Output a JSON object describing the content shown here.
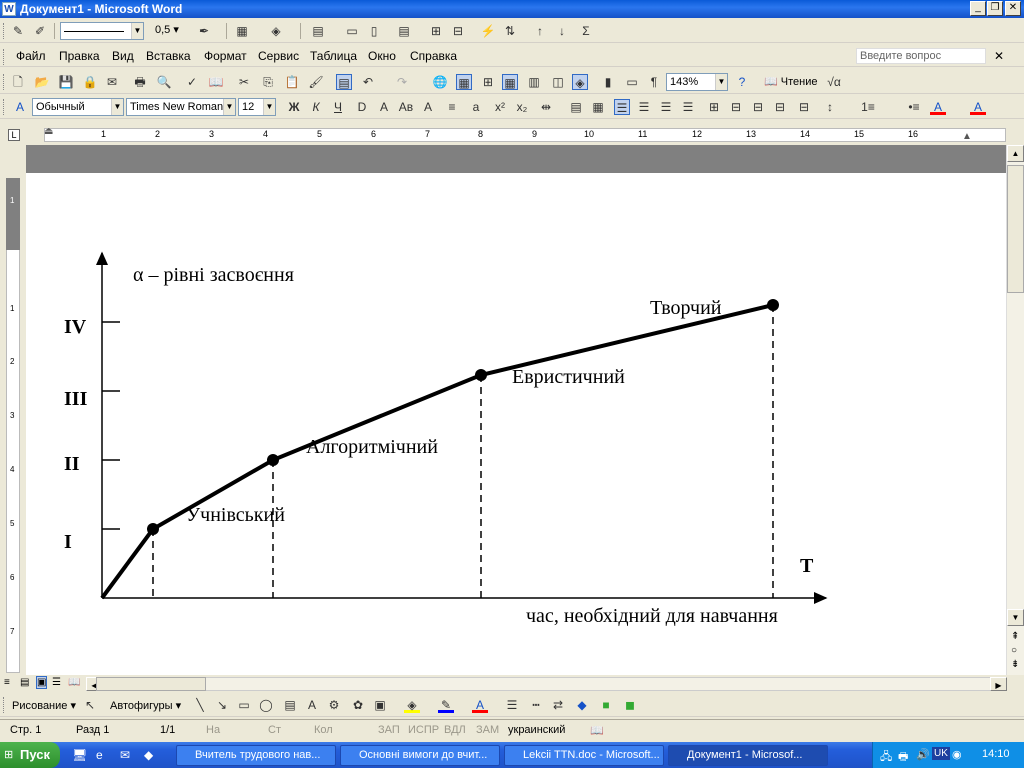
{
  "window": {
    "title": "Документ1 - Microsoft Word",
    "app_icon": "word-icon"
  },
  "toolbar_top": {
    "line_weight": "0,5"
  },
  "menu": {
    "items": [
      "Файл",
      "Правка",
      "Вид",
      "Вставка",
      "Формат",
      "Сервис",
      "Таблица",
      "Окно",
      "Справка"
    ],
    "ask_placeholder": "Введите вопрос"
  },
  "standard_toolbar": {
    "zoom": "143%",
    "read_label": "Чтение"
  },
  "formatting_toolbar": {
    "style": "Обычный",
    "font": "Times New Roman",
    "size": "12"
  },
  "ruler": {
    "numbers": [
      "1",
      "2",
      "3",
      "4",
      "5",
      "6",
      "7",
      "8",
      "9",
      "10",
      "11",
      "12",
      "13",
      "14",
      "15",
      "16"
    ]
  },
  "vruler": {
    "numbers": [
      "1",
      "1",
      "2",
      "3",
      "4",
      "5",
      "6",
      "7"
    ]
  },
  "chart_data": {
    "type": "line",
    "ylabel": "α – рівні засвоєння",
    "xlabel": "час, необхідний для навчання",
    "x_axis_letter": "T",
    "y_levels": [
      "I",
      "II",
      "III",
      "IV"
    ],
    "series": [
      {
        "points": [
          {
            "x": 0,
            "y": 0,
            "label": ""
          },
          {
            "x": 1,
            "y": 1,
            "label": "Учнівський"
          },
          {
            "x": 2,
            "y": 2,
            "label": "Алгоритмічний"
          },
          {
            "x": 3,
            "y": 3,
            "label": "Евристичний"
          },
          {
            "x": 4,
            "y": 4,
            "label": "Творчий"
          }
        ]
      }
    ],
    "ylim": [
      0,
      4
    ],
    "dashed_drops": true
  },
  "drawing_toolbar": {
    "draw_label": "Рисование",
    "autoshapes_label": "Автофигуры"
  },
  "status": {
    "page": "Стр.  1",
    "section": "Разд  1",
    "pages": "1/1",
    "at": "На",
    "line": "Ст",
    "col": "Кол",
    "rec": "ЗАП",
    "trk": "ИСПР",
    "ext": "ВДЛ",
    "ovr": "ЗАМ",
    "language": "украинский"
  },
  "taskbar": {
    "start": "Пуск",
    "buttons": [
      "Вчитель трудового нав...",
      "Основні вимоги до вчит...",
      "Lekcii TTN.doc - Microsoft...",
      "Документ1 - Microsof..."
    ],
    "lang": "UK",
    "clock": "14:10"
  }
}
